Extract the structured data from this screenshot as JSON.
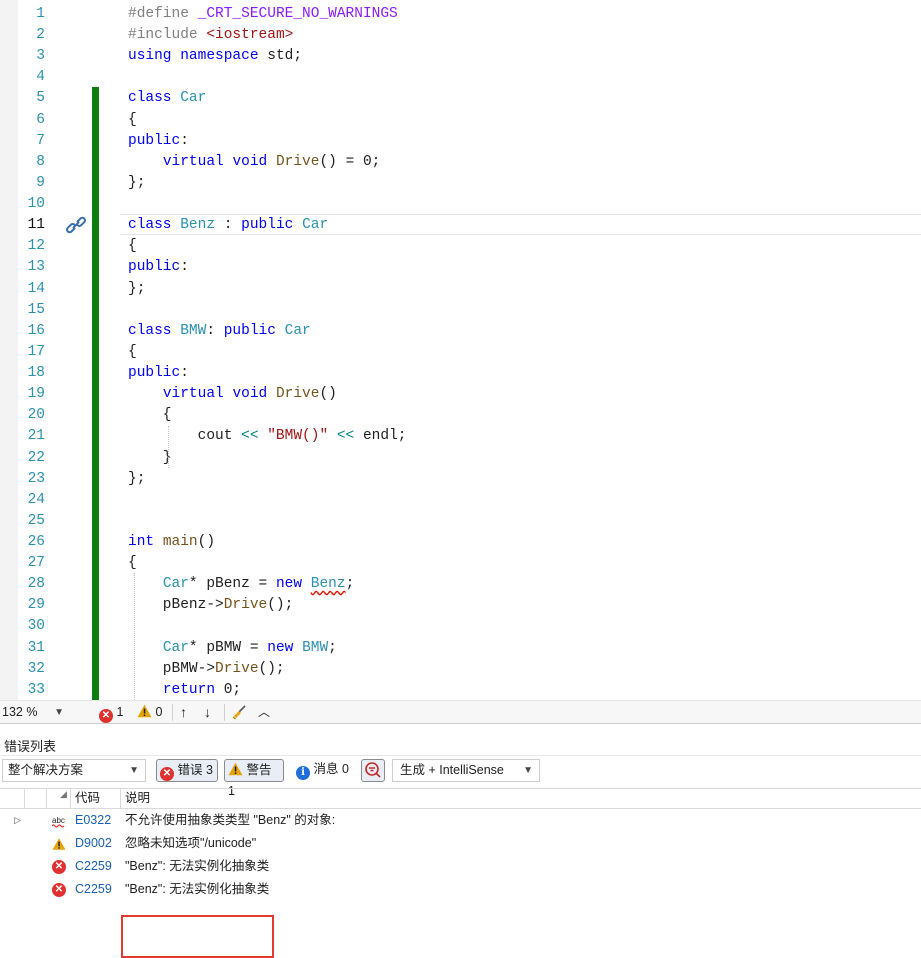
{
  "editor": {
    "current_line": 11,
    "lines": [
      {
        "n": "1",
        "tokens": [
          [
            "#define ",
            "tok-pp"
          ],
          [
            "_CRT_SECURE_NO_WARNINGS",
            "tok-macro"
          ]
        ]
      },
      {
        "n": "2",
        "tokens": [
          [
            "#include ",
            "tok-pp"
          ],
          [
            "<iostream>",
            "tok-str"
          ]
        ]
      },
      {
        "n": "3",
        "tokens": [
          [
            "using",
            "tok-kw"
          ],
          [
            " ",
            "tok-punc"
          ],
          [
            "namespace",
            "tok-kw"
          ],
          [
            " std;",
            "tok-ident"
          ]
        ]
      },
      {
        "n": "4",
        "tokens": []
      },
      {
        "n": "5",
        "tokens": [
          [
            "class",
            "tok-kw"
          ],
          [
            " ",
            "tok-punc"
          ],
          [
            "Car",
            "tok-type"
          ]
        ]
      },
      {
        "n": "6",
        "tokens": [
          [
            "{",
            "tok-punc"
          ]
        ]
      },
      {
        "n": "7",
        "tokens": [
          [
            "public",
            "tok-kw"
          ],
          [
            ":",
            "tok-punc"
          ]
        ]
      },
      {
        "n": "8",
        "tokens": [
          [
            "    ",
            "tok-punc"
          ],
          [
            "virtual",
            "tok-kw"
          ],
          [
            " ",
            "tok-punc"
          ],
          [
            "void",
            "tok-kw"
          ],
          [
            " ",
            "tok-punc"
          ],
          [
            "Drive",
            "tok-fn"
          ],
          [
            "() = 0;",
            "tok-punc"
          ]
        ]
      },
      {
        "n": "9",
        "tokens": [
          [
            "};",
            "tok-punc"
          ]
        ]
      },
      {
        "n": "10",
        "tokens": []
      },
      {
        "n": "11",
        "tokens": [
          [
            "class",
            "tok-kw"
          ],
          [
            " ",
            "tok-punc"
          ],
          [
            "Benz",
            "tok-type"
          ],
          [
            " : ",
            "tok-punc"
          ],
          [
            "public",
            "tok-kw"
          ],
          [
            " ",
            "tok-punc"
          ],
          [
            "Car",
            "tok-type"
          ]
        ]
      },
      {
        "n": "12",
        "tokens": [
          [
            "{",
            "tok-punc"
          ]
        ]
      },
      {
        "n": "13",
        "tokens": [
          [
            "public",
            "tok-kw"
          ],
          [
            ":",
            "tok-punc"
          ]
        ]
      },
      {
        "n": "14",
        "tokens": [
          [
            "};",
            "tok-punc"
          ]
        ]
      },
      {
        "n": "15",
        "tokens": []
      },
      {
        "n": "16",
        "tokens": [
          [
            "class",
            "tok-kw"
          ],
          [
            " ",
            "tok-punc"
          ],
          [
            "BMW",
            "tok-type"
          ],
          [
            ": ",
            "tok-punc"
          ],
          [
            "public",
            "tok-kw"
          ],
          [
            " ",
            "tok-punc"
          ],
          [
            "Car",
            "tok-type"
          ]
        ]
      },
      {
        "n": "17",
        "tokens": [
          [
            "{",
            "tok-punc"
          ]
        ]
      },
      {
        "n": "18",
        "tokens": [
          [
            "public",
            "tok-kw"
          ],
          [
            ":",
            "tok-punc"
          ]
        ]
      },
      {
        "n": "19",
        "tokens": [
          [
            "    ",
            "tok-punc"
          ],
          [
            "virtual",
            "tok-kw"
          ],
          [
            " ",
            "tok-punc"
          ],
          [
            "void",
            "tok-kw"
          ],
          [
            " ",
            "tok-punc"
          ],
          [
            "Drive",
            "tok-fn"
          ],
          [
            "()",
            "tok-punc"
          ]
        ]
      },
      {
        "n": "20",
        "tokens": [
          [
            "    {",
            "tok-punc"
          ]
        ]
      },
      {
        "n": "21",
        "tokens": [
          [
            "        cout ",
            "tok-ident"
          ],
          [
            "<<",
            "tok-op"
          ],
          [
            " ",
            "tok-punc"
          ],
          [
            "\"BMW()\"",
            "tok-str"
          ],
          [
            " ",
            "tok-punc"
          ],
          [
            "<<",
            "tok-op"
          ],
          [
            " endl;",
            "tok-ident"
          ]
        ]
      },
      {
        "n": "22",
        "tokens": [
          [
            "    }",
            "tok-punc"
          ]
        ]
      },
      {
        "n": "23",
        "tokens": [
          [
            "};",
            "tok-punc"
          ]
        ]
      },
      {
        "n": "24",
        "tokens": []
      },
      {
        "n": "25",
        "tokens": []
      },
      {
        "n": "26",
        "tokens": [
          [
            "int",
            "tok-kw"
          ],
          [
            " ",
            "tok-punc"
          ],
          [
            "main",
            "tok-fn"
          ],
          [
            "()",
            "tok-punc"
          ]
        ]
      },
      {
        "n": "27",
        "tokens": [
          [
            "{",
            "tok-punc"
          ]
        ]
      },
      {
        "n": "28",
        "tokens": [
          [
            "    ",
            "tok-punc"
          ],
          [
            "Car",
            "tok-type"
          ],
          [
            "* pBenz = ",
            "tok-ident"
          ],
          [
            "new",
            "tok-kw"
          ],
          [
            " ",
            "tok-punc"
          ],
          [
            "Benz",
            "tok-err"
          ],
          [
            ";",
            "tok-punc"
          ]
        ]
      },
      {
        "n": "29",
        "tokens": [
          [
            "    pBenz->",
            "tok-ident"
          ],
          [
            "Drive",
            "tok-fn"
          ],
          [
            "();",
            "tok-punc"
          ]
        ]
      },
      {
        "n": "30",
        "tokens": []
      },
      {
        "n": "31",
        "tokens": [
          [
            "    ",
            "tok-punc"
          ],
          [
            "Car",
            "tok-type"
          ],
          [
            "* pBMW = ",
            "tok-ident"
          ],
          [
            "new",
            "tok-kw"
          ],
          [
            " ",
            "tok-punc"
          ],
          [
            "BMW",
            "tok-type"
          ],
          [
            ";",
            "tok-punc"
          ]
        ]
      },
      {
        "n": "32",
        "tokens": [
          [
            "    pBMW->",
            "tok-ident"
          ],
          [
            "Drive",
            "tok-fn"
          ],
          [
            "();",
            "tok-punc"
          ]
        ]
      },
      {
        "n": "33",
        "tokens": [
          [
            "    ",
            "tok-punc"
          ],
          [
            "return",
            "tok-kw"
          ],
          [
            " 0;",
            "tok-ident"
          ]
        ]
      }
    ]
  },
  "status_bar": {
    "zoom": "132 %",
    "error_count": "1",
    "warning_count": "0"
  },
  "error_list": {
    "title": "错误列表",
    "scope": "整个解决方案",
    "errors_label": "错误 3",
    "warnings_label": "警告 1",
    "messages_label": "消息 0",
    "build_filter": "生成 + IntelliSense",
    "columns": {
      "code": "代码",
      "description": "说明"
    },
    "rows": [
      {
        "severity": "intellisense",
        "code": "E0322",
        "description": "不允许使用抽象类类型 \"Benz\" 的对象:",
        "expandable": true
      },
      {
        "severity": "warning",
        "code": "D9002",
        "description": "忽略未知选项\"/unicode\"",
        "expandable": false
      },
      {
        "severity": "error",
        "code": "C2259",
        "description": "\"Benz\": 无法实例化抽象类",
        "expandable": false
      },
      {
        "severity": "error",
        "code": "C2259",
        "description": "\"Benz\": 无法实例化抽象类",
        "expandable": false
      }
    ]
  },
  "colors": {
    "keyword": "#0000ff",
    "type": "#2b91af",
    "string": "#a31515",
    "function": "#74531f",
    "change_bar": "#107c10",
    "highlight_box": "#e03c31"
  }
}
